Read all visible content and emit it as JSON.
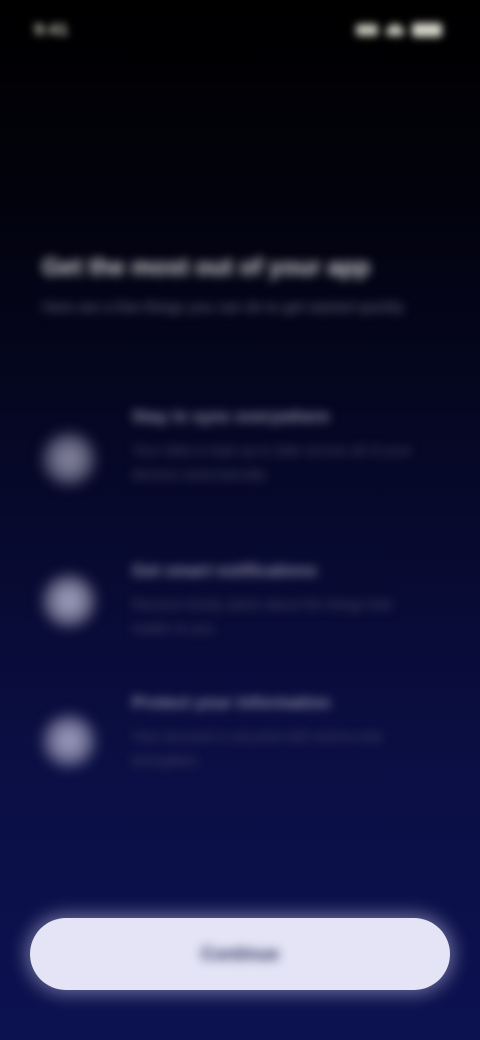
{
  "status_bar": {
    "time": "9:41",
    "icons": [
      "signal-icon",
      "wifi-icon",
      "battery-icon"
    ]
  },
  "header": {
    "title": "Get the most out of your app",
    "subtitle": "Here are a few things you can do to get started quickly"
  },
  "features": [
    {
      "icon": "feature-icon",
      "title": "Stay in sync everywhere",
      "description": "Your data is kept up to date across all of your devices automatically."
    },
    {
      "icon": "feature-icon",
      "title": "Get smart notifications",
      "description": "Receive timely alerts about the things that matter to you."
    },
    {
      "icon": "feature-icon",
      "title": "Protect your information",
      "description": "Your account is secured with end-to-end encryption."
    }
  ],
  "primary_button": {
    "label": "Continue"
  },
  "colors": {
    "background_top": "#000000",
    "background_bottom": "#0c1150",
    "button": "#e4e4f6",
    "button_text": "#2a2d5a"
  }
}
